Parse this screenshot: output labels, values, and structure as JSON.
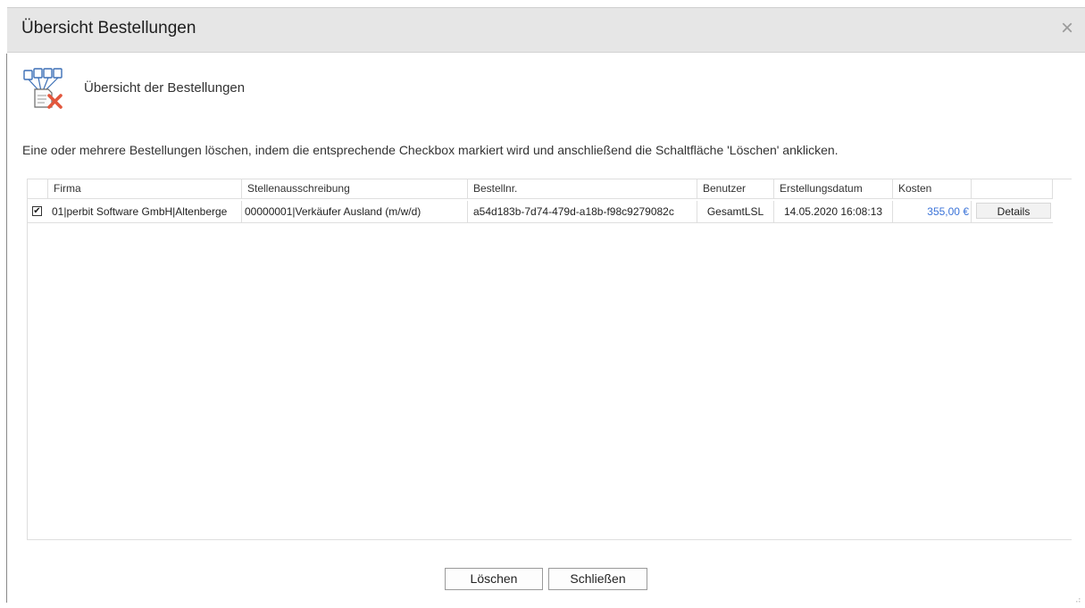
{
  "window": {
    "title": "Übersicht Bestellungen",
    "close_icon": "close-icon"
  },
  "header": {
    "icon": "orders-delete-icon",
    "label": "Übersicht der Bestellungen"
  },
  "instructions": "Eine oder mehrere Bestellungen löschen, indem die entsprechende Checkbox markiert wird und anschließend die Schaltfläche 'Löschen' anklicken.",
  "table": {
    "columns": [
      "Firma",
      "Stellenausschreibung",
      "Bestellnr.",
      "Benutzer",
      "Erstellungsdatum",
      "Kosten"
    ],
    "rows": [
      {
        "checked": true,
        "firma": "01|perbit Software GmbH|Altenberge",
        "stelle": "00000001|Verkäufer Ausland (m/w/d)",
        "bestellnr": "a54d183b-7d74-479d-a18b-f98c9279082c",
        "benutzer": "GesamtLSL",
        "datum": "14.05.2020 16:08:13",
        "kosten": "355,00 €",
        "details_label": "Details"
      }
    ]
  },
  "buttons": {
    "delete": "Löschen",
    "close": "Schließen"
  },
  "colors": {
    "titlebar": "#e6e6e6",
    "cost_link": "#3b73d8",
    "icon_red": "#e2573d",
    "icon_blue": "#3b6fb6"
  }
}
